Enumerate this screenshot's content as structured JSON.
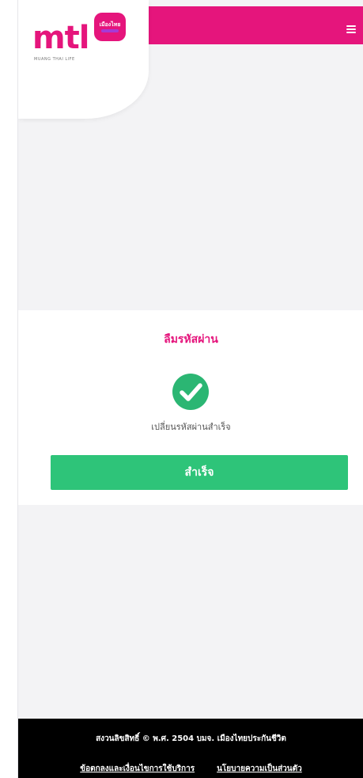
{
  "header": {
    "logo": {
      "text": "mtl",
      "badge_text": "เมืองไทย",
      "subtext": "MUANG THAI LIFE"
    },
    "menu_icon": "hamburger-icon",
    "brand_color": "#e5157c"
  },
  "card": {
    "title": "ลืมรหัสผ่าน",
    "status_icon": "check-circle-icon",
    "message": "เปลี่ยนรหัสผ่านสำเร็จ",
    "done_label": "สำเร็จ",
    "success_color": "#2ec479"
  },
  "footer": {
    "copyright": "สงวนลิขสิทธิ์ © พ.ศ. 2504 บมจ. เมืองไทยประกันชีวิต",
    "links": [
      "ข้อตกลงและเงื่อนไขการใช้บริการ",
      "นโยบายความเป็นส่วนตัว"
    ]
  }
}
